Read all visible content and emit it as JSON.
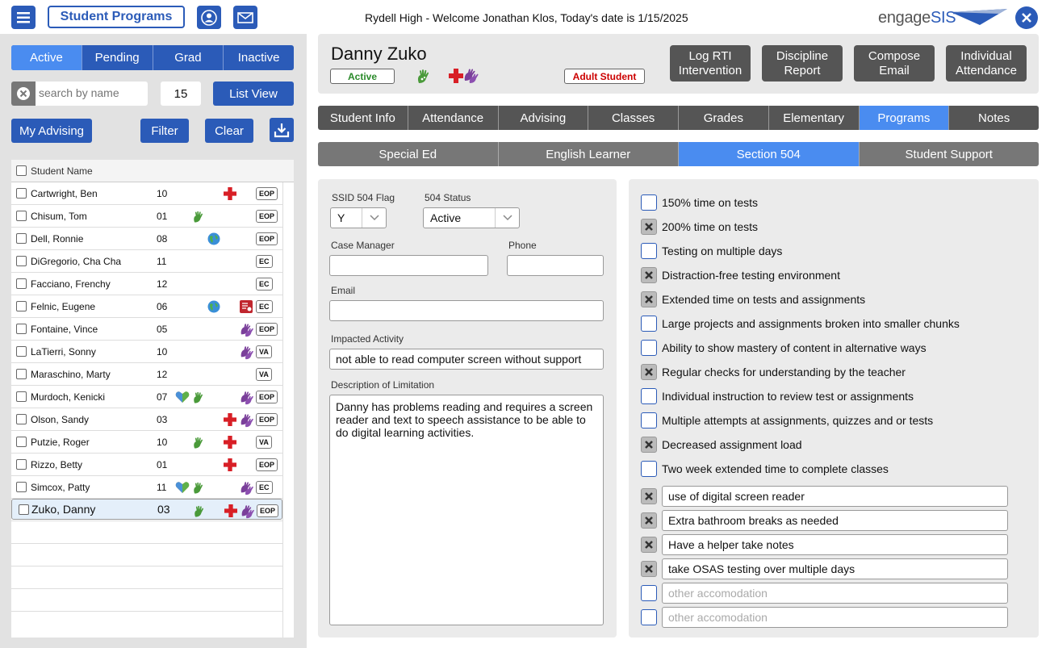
{
  "topbar": {
    "programs_label": "Student Programs",
    "welcome": "Rydell High - Welcome Jonathan Klos, Today's date is 1/15/2025",
    "logo_prefix": "engage",
    "logo_suffix": "SIS"
  },
  "left": {
    "tabs": [
      "Active",
      "Pending",
      "Grad",
      "Inactive"
    ],
    "active_tab": "Active",
    "search_placeholder": "search by name",
    "count": "15",
    "list_view_label": "List View",
    "my_advising_label": "My Advising",
    "filter_label": "Filter",
    "clear_label": "Clear",
    "column_header": "Student Name",
    "students": [
      {
        "name": "Cartwright, Ben",
        "grade": "10",
        "badge": "EOP",
        "icons": [
          "medical-icon"
        ]
      },
      {
        "name": "Chisum, Tom",
        "grade": "01",
        "badge": "EOP",
        "icons": [
          "hand-icon"
        ]
      },
      {
        "name": "Dell, Ronnie",
        "grade": "08",
        "badge": "EOP",
        "icons": [
          "globe-icon"
        ]
      },
      {
        "name": "DiGregorio, Cha Cha",
        "grade": "11",
        "badge": "EC",
        "icons": []
      },
      {
        "name": "Facciano, Frenchy",
        "grade": "12",
        "badge": "EC",
        "icons": []
      },
      {
        "name": "Felnic, Eugene",
        "grade": "06",
        "badge": "EC",
        "icons": [
          "globe-icon",
          "document-icon"
        ]
      },
      {
        "name": "Fontaine, Vince",
        "grade": "05",
        "badge": "EOP",
        "icons": [
          "purple-hands-icon"
        ]
      },
      {
        "name": "LaTierri, Sonny",
        "grade": "10",
        "badge": "VA",
        "icons": [
          "purple-hands-icon"
        ]
      },
      {
        "name": "Maraschino, Marty",
        "grade": "12",
        "badge": "VA",
        "icons": []
      },
      {
        "name": "Murdoch, Kenicki",
        "grade": "07",
        "badge": "EOP",
        "icons": [
          "heart-icon",
          "hand-icon",
          "purple-hands-icon"
        ]
      },
      {
        "name": "Olson, Sandy",
        "grade": "03",
        "badge": "EOP",
        "icons": [
          "medical-icon",
          "purple-hands-icon"
        ]
      },
      {
        "name": "Putzie, Roger",
        "grade": "10",
        "badge": "VA",
        "icons": [
          "hand-icon",
          "medical-icon"
        ]
      },
      {
        "name": "Rizzo, Betty",
        "grade": "01",
        "badge": "EOP",
        "icons": [
          "medical-icon"
        ]
      },
      {
        "name": "Simcox, Patty",
        "grade": "11",
        "badge": "EC",
        "icons": [
          "heart-icon",
          "hand-icon",
          "purple-hands-icon"
        ]
      },
      {
        "name": "Zuko, Danny",
        "grade": "03",
        "badge": "EOP",
        "icons": [
          "hand-icon",
          "medical-icon",
          "purple-hands-icon"
        ],
        "selected": true
      }
    ]
  },
  "student": {
    "name": "Danny Zuko",
    "status": "Active",
    "adult_label": "Adult Student",
    "actions": [
      {
        "line1": "Log RTI",
        "line2": "Intervention"
      },
      {
        "line1": "Discipline",
        "line2": "Report"
      },
      {
        "line1": "Compose",
        "line2": "Email"
      },
      {
        "line1": "Individual",
        "line2": "Attendance"
      }
    ]
  },
  "nav_tabs": [
    "Student Info",
    "Attendance",
    "Advising",
    "Classes",
    "Grades",
    "Elementary",
    "Programs",
    "Notes"
  ],
  "active_nav": "Programs",
  "sub_tabs": [
    "Special Ed",
    "English Learner",
    "Section 504",
    "Student Support"
  ],
  "active_sub": "Section 504",
  "form": {
    "flag_label": "SSID 504 Flag",
    "flag_value": "Y",
    "status_label": "504 Status",
    "status_value": "Active",
    "case_manager_label": "Case Manager",
    "case_manager_value": "",
    "phone_label": "Phone",
    "phone_value": "",
    "email_label": "Email",
    "email_value": "",
    "impacted_label": "Impacted Activity",
    "impacted_value": "not able to read computer screen without support",
    "description_label": "Description of Limitation",
    "description_value": "Danny has problems reading and requires a screen reader and text to speech assistance to be able to do digital learning activities."
  },
  "accommodations": [
    {
      "label": "150% time on tests",
      "checked": false
    },
    {
      "label": "200% time on tests",
      "checked": true
    },
    {
      "label": "Testing on multiple days",
      "checked": false
    },
    {
      "label": "Distraction-free testing environment",
      "checked": true
    },
    {
      "label": "Extended time on tests and assignments",
      "checked": true
    },
    {
      "label": "Large projects and assignments broken into smaller chunks",
      "checked": false
    },
    {
      "label": "Ability to show mastery of content in alternative ways",
      "checked": false
    },
    {
      "label": "Regular checks for understanding by the teacher",
      "checked": true
    },
    {
      "label": "Individual instruction to review test or assignments",
      "checked": false
    },
    {
      "label": "Multiple attempts at assignments, quizzes and or tests",
      "checked": false
    },
    {
      "label": "Decreased assignment load",
      "checked": true
    },
    {
      "label": "Two week extended time to complete classes",
      "checked": false
    }
  ],
  "other_accommodations": [
    {
      "value": "use of digital screen reader",
      "checked": true
    },
    {
      "value": "Extra bathroom breaks as needed",
      "checked": true
    },
    {
      "value": "Have a helper take notes",
      "checked": true
    },
    {
      "value": "take OSAS testing over multiple days",
      "checked": true
    },
    {
      "value": "",
      "checked": false
    },
    {
      "value": "",
      "checked": false
    }
  ],
  "other_placeholder": "other accomodation",
  "colors": {
    "brand": "#2b5bb8",
    "active_tab": "#4a8cf0",
    "dark_tab": "#555555"
  }
}
